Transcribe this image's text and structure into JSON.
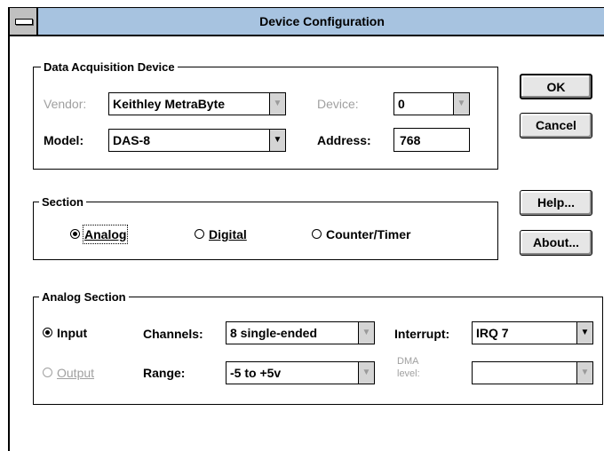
{
  "window": {
    "title": "Device Configuration"
  },
  "daq": {
    "legend": "Data Acquisition Device",
    "vendor_label": "Vendor:",
    "vendor_value": "Keithley MetraByte",
    "device_label": "Device:",
    "device_value": "0",
    "model_label": "Model:",
    "model_value": "DAS-8",
    "address_label": "Address:",
    "address_value": "768"
  },
  "buttons": {
    "ok": "OK",
    "cancel": "Cancel",
    "help": "Help...",
    "about": "About..."
  },
  "section": {
    "legend": "Section",
    "options": [
      "Analog",
      "Digital",
      "Counter/Timer"
    ],
    "selected": "Analog"
  },
  "analog": {
    "legend": "Analog Section",
    "input_label": "Input",
    "output_label": "Output",
    "mode_selected": "Input",
    "channels_label": "Channels:",
    "channels_value": "8 single-ended",
    "range_label": "Range:",
    "range_value": "-5 to +5v",
    "interrupt_label": "Interrupt:",
    "interrupt_value": "IRQ 7",
    "dma_label_1": "DMA",
    "dma_label_2": "level:",
    "dma_value": ""
  },
  "icons": {
    "combo_arrow": "down-arrow-icon",
    "system_menu": "system-menu-icon"
  }
}
